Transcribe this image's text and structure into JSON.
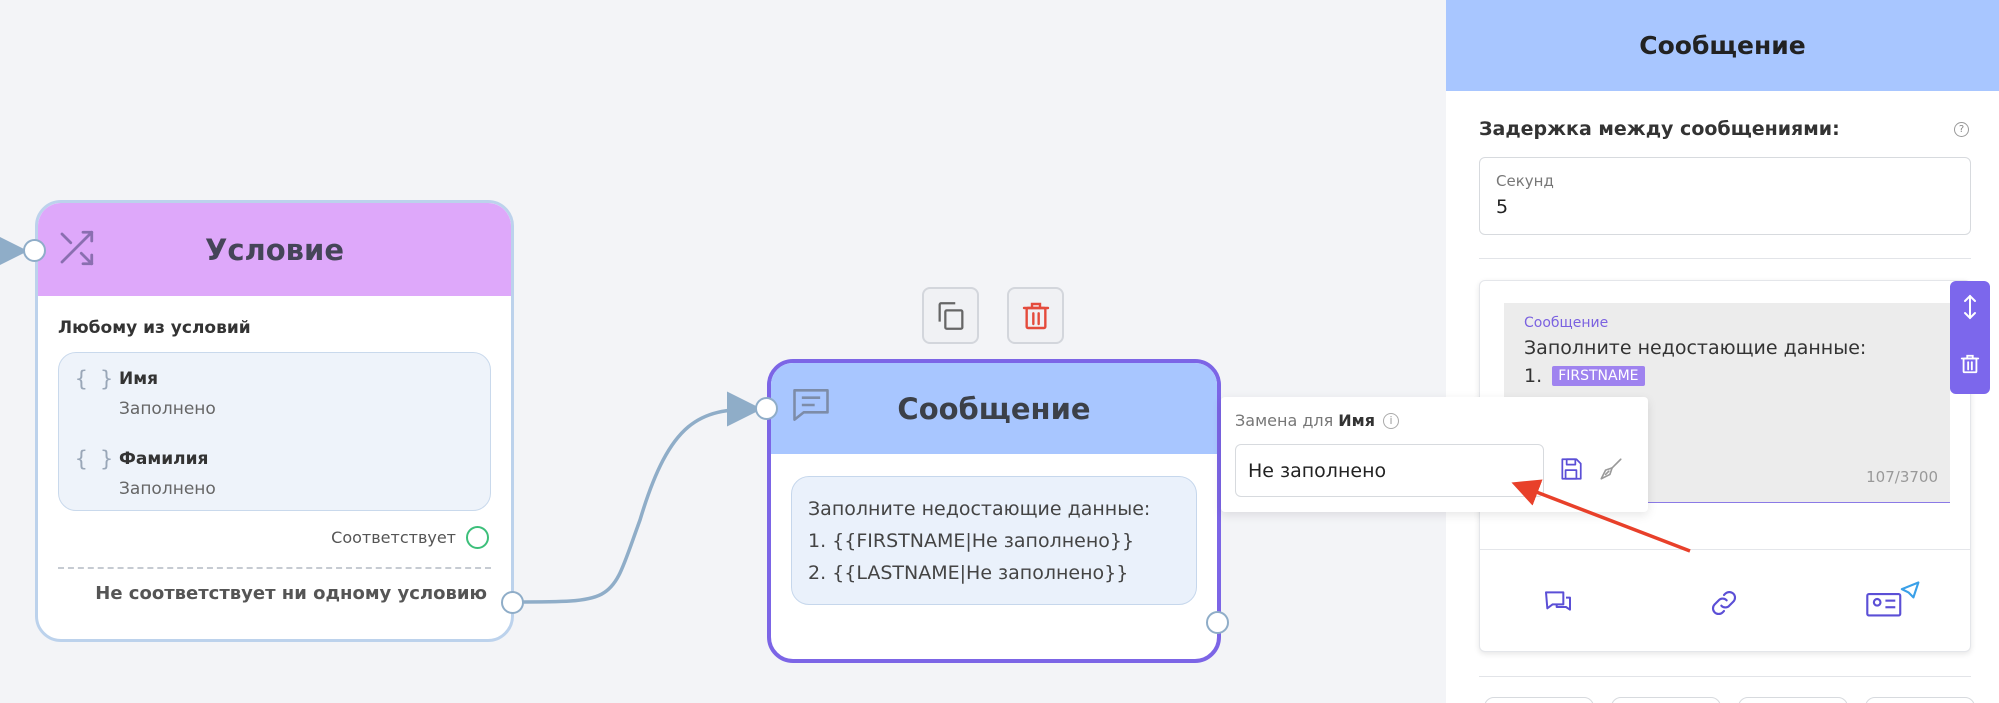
{
  "condition_node": {
    "title": "Условие",
    "mode_label": "Любому из условий",
    "conditions": [
      {
        "field": "Имя",
        "state": "Заполнено"
      },
      {
        "field": "Фамилия",
        "state": "Заполнено"
      }
    ],
    "match_label": "Соответствует",
    "no_match_label": "Не соответствует ни одному условию"
  },
  "message_node": {
    "title": "Сообщение",
    "lines": [
      "Заполните недостающие данные:",
      "1. {{FIRSTNAME|Не заполнено}}",
      "2. {{LASTNAME|Не заполнено}}"
    ]
  },
  "popup": {
    "label_prefix": "Замена для",
    "field_name": "Имя",
    "value": "Не заполнено"
  },
  "panel": {
    "title": "Сообщение",
    "delay_label": "Задержка между сообщениями:",
    "seconds_label": "Секунд",
    "seconds_value": "5",
    "editor": {
      "label": "Сообщение",
      "line1": "Заполните недостающие данные:",
      "line2_prefix": "1.",
      "tag": "FIRSTNAME",
      "counter": "107/3700"
    }
  },
  "colors": {
    "accent": "#7c65e6",
    "condition_header": "#dea8fa",
    "message_header": "#a8c6ff",
    "arrow": "#e8402a",
    "match": "#3cbf7a"
  },
  "icons": [
    "shuffle-icon",
    "chat-icon",
    "copy-icon",
    "trash-icon",
    "save-icon",
    "broom-icon",
    "messages-icon",
    "link-icon",
    "contact-card-icon",
    "resize-icon",
    "help-icon"
  ]
}
